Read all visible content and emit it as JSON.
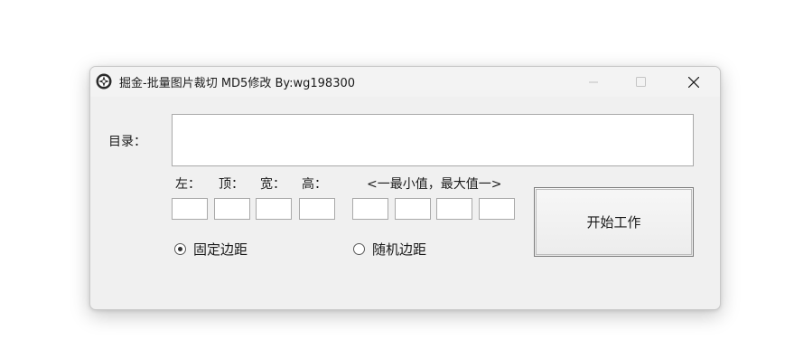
{
  "window": {
    "title": "掘金-批量图片裁切 MD5修改 By:wg198300",
    "icons": {
      "app": "app-logo-icon",
      "minimize": "minimize-icon",
      "maximize": "maximize-icon",
      "close": "close-icon"
    }
  },
  "form": {
    "directory_label": "目录：",
    "directory_value": "",
    "margins": {
      "left_label": "左：",
      "top_label": "顶：",
      "width_label": "宽：",
      "height_label": "高：",
      "left_value": "",
      "top_value": "",
      "width_value": "",
      "height_value": ""
    },
    "range": {
      "label": "<一最小值，最大值一>",
      "values": [
        "",
        "",
        "",
        ""
      ]
    },
    "radio_fixed": {
      "label": "固定边距",
      "checked": true
    },
    "radio_random": {
      "label": "随机边距",
      "checked": false
    },
    "start_button": "开始工作"
  },
  "colors": {
    "window_bg": "#f0f0f0",
    "input_border": "#a9a9a9",
    "button_border": "#7d7d7d"
  }
}
